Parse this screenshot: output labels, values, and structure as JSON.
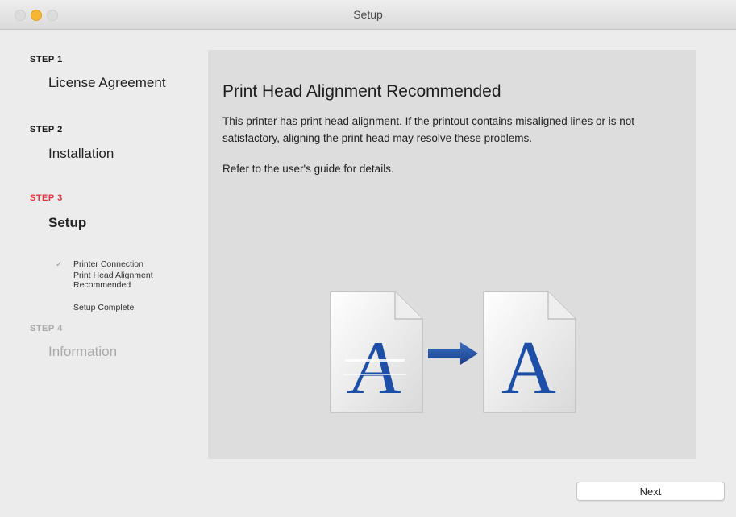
{
  "window": {
    "title": "Setup"
  },
  "steps": [
    {
      "label": "STEP 1",
      "name": "License Agreement",
      "state": "done"
    },
    {
      "label": "STEP 2",
      "name": "Installation",
      "state": "done"
    },
    {
      "label": "STEP 3",
      "name": "Setup",
      "state": "active"
    },
    {
      "label": "STEP 4",
      "name": "Information",
      "state": "future"
    }
  ],
  "substeps": [
    {
      "label": "Printer Connection",
      "done": true
    },
    {
      "label": "Print Head Alignment Recommended",
      "done": false
    },
    {
      "label": "Setup Complete",
      "done": false
    }
  ],
  "content": {
    "heading": "Print Head Alignment Recommended",
    "description": "This printer has print head alignment. If the printout contains misaligned lines or is not satisfactory, aligning the print head may resolve these problems.",
    "reference": "Refer to the user's guide for details.",
    "letter_before": "A",
    "letter_after": "A"
  },
  "buttons": {
    "next": "Next"
  },
  "colors": {
    "active_step": "#e8333b",
    "inactive_step": "#a9a9a9",
    "letter_blue": "#1d4fa8"
  }
}
